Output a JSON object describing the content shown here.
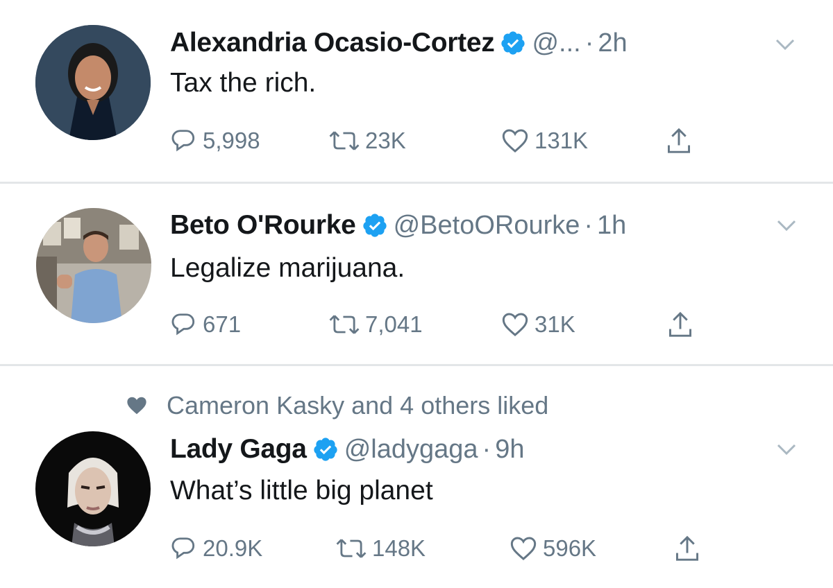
{
  "tweets": [
    {
      "name": "Alexandria Ocasio-Cortez",
      "handle": "@...",
      "separator": "·",
      "time": "2h",
      "text": "Tax the rich.",
      "replies": "5,998",
      "retweets": "23K",
      "likes": "131K"
    },
    {
      "name": "Beto O'Rourke",
      "handle": "@BetoORourke",
      "separator": "·",
      "time": "1h",
      "text": "Legalize marijuana.",
      "replies": "671",
      "retweets": "7,041",
      "likes": "31K"
    },
    {
      "social_context": "Cameron Kasky and 4 others liked",
      "name": "Lady Gaga",
      "handle": "@ladygaga",
      "separator": "·",
      "time": "9h",
      "text": "What’s little big planet",
      "replies": "20.9K",
      "retweets": "148K",
      "likes": "596K"
    }
  ],
  "colors": {
    "verified": "#1da1f2",
    "secondary_text": "#657786",
    "primary_text": "#14171a",
    "divider": "#e3e6e8"
  },
  "icons": {
    "reply": "reply-icon",
    "retweet": "retweet-icon",
    "like": "heart-icon",
    "share": "share-icon",
    "verified": "verified-badge-icon",
    "menu": "chevron-down-icon"
  }
}
